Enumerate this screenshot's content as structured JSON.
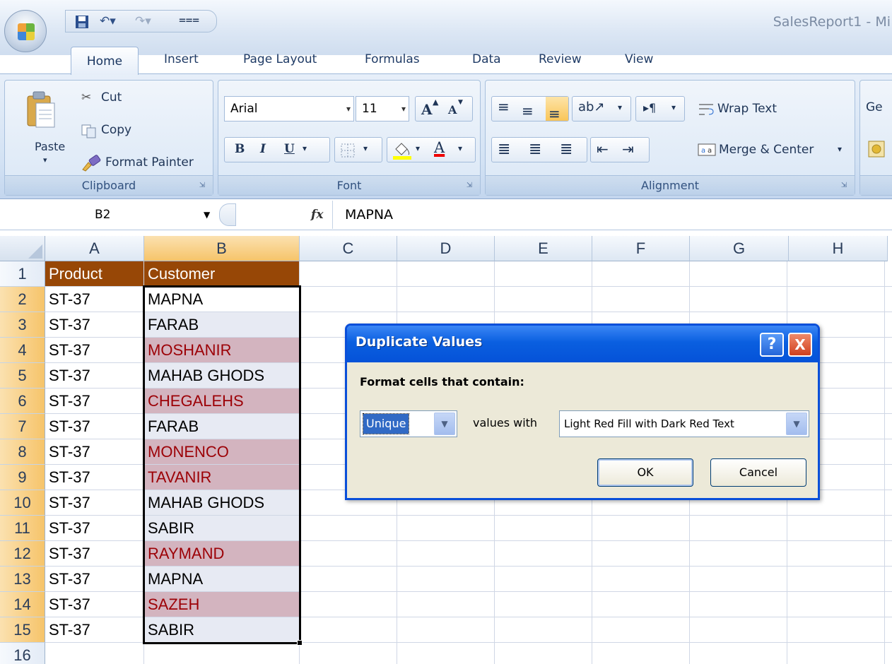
{
  "window": {
    "title": "SalesReport1 - Mi"
  },
  "quick_access": {
    "save_icon": "save-icon",
    "undo_icon": "undo-icon",
    "redo_icon": "redo-icon",
    "customize_icon": "customize-icon"
  },
  "tabs": [
    {
      "label": "Home"
    },
    {
      "label": "Insert"
    },
    {
      "label": "Page Layout"
    },
    {
      "label": "Formulas"
    },
    {
      "label": "Data"
    },
    {
      "label": "Review"
    },
    {
      "label": "View"
    }
  ],
  "ribbon": {
    "clipboard": {
      "label": "Clipboard",
      "paste": "Paste",
      "cut": "Cut",
      "copy": "Copy",
      "format_painter": "Format Painter"
    },
    "font": {
      "label": "Font",
      "name": "Arial",
      "size": "11",
      "bold": "B",
      "italic": "I",
      "underline": "U",
      "font_color_glyph": "A",
      "grow_glyph": "A",
      "shrink_glyph": "A"
    },
    "alignment": {
      "label": "Alignment",
      "wrap_text": "Wrap Text",
      "merge_center": "Merge & Center"
    },
    "number": {
      "label": "Ge"
    }
  },
  "formula_bar": {
    "name_box": "B2",
    "fx": "fx",
    "value": "MAPNA"
  },
  "columns": [
    "A",
    "B",
    "C",
    "D",
    "E",
    "F",
    "G",
    "H"
  ],
  "headers": {
    "product": "Product",
    "customer": "Customer"
  },
  "rows": [
    {
      "num": "1",
      "a": "Product",
      "b": "Customer"
    },
    {
      "num": "2",
      "a": "ST-37",
      "b": "MAPNA"
    },
    {
      "num": "3",
      "a": "ST-37",
      "b": "FARAB"
    },
    {
      "num": "4",
      "a": "ST-37",
      "b": "MOSHANIR"
    },
    {
      "num": "5",
      "a": "ST-37",
      "b": "MAHAB GHODS"
    },
    {
      "num": "6",
      "a": "ST-37",
      "b": "CHEGALEHS"
    },
    {
      "num": "7",
      "a": "ST-37",
      "b": "FARAB"
    },
    {
      "num": "8",
      "a": "ST-37",
      "b": "MONENCO"
    },
    {
      "num": "9",
      "a": "ST-37",
      "b": "TAVANIR"
    },
    {
      "num": "10",
      "a": "ST-37",
      "b": "MAHAB GHODS"
    },
    {
      "num": "11",
      "a": "ST-37",
      "b": "SABIR"
    },
    {
      "num": "12",
      "a": "ST-37",
      "b": "RAYMAND"
    },
    {
      "num": "13",
      "a": "ST-37",
      "b": "MAPNA"
    },
    {
      "num": "14",
      "a": "ST-37",
      "b": "SAZEH"
    },
    {
      "num": "15",
      "a": "ST-37",
      "b": "SABIR"
    },
    {
      "num": "16",
      "a": "",
      "b": ""
    }
  ],
  "dialog": {
    "title": "Duplicate Values",
    "prompt": "Format cells that contain:",
    "type_value": "Unique",
    "values_with": "values with",
    "format_value": "Light Red Fill with Dark Red Text",
    "ok": "OK",
    "cancel": "Cancel",
    "help_glyph": "?",
    "close_glyph": "X"
  },
  "colors": {
    "header_fill": "#974706",
    "dup_fill": "#d3b4bf",
    "dup_text": "#9c0006",
    "dialog_title": "#0a5fe0"
  }
}
